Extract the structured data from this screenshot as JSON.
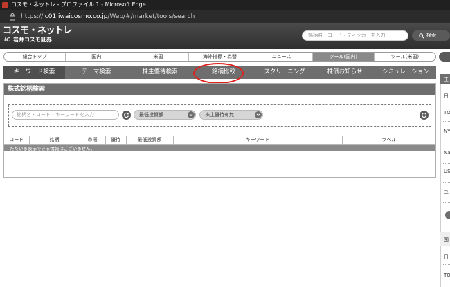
{
  "browser": {
    "title": "コスモ・ネットレ - プロファイル 1 - Microsoft Edge",
    "url_prefix": "https://",
    "url_host": "ic01.iwaicosmo.co.jp",
    "url_path": "/Web/#/market/tools/search"
  },
  "header": {
    "logo_line1": "コスモ・ネットレ",
    "logo_mark": "IC",
    "logo_line2": "岩井コスモ証券",
    "search_placeholder": "銘柄名・コード・ティッカーを入力",
    "search_button": "検索"
  },
  "global_nav": [
    "総合トップ",
    "国内",
    "米国",
    "海外指標・為替",
    "ニュース",
    "ツール(国内)",
    "ツール(米国)"
  ],
  "global_nav_active": 5,
  "sub_nav": [
    "キーワード検索",
    "テーマ検索",
    "株主優待検索",
    "銘柄比較",
    "スクリーニング",
    "株価お知らせ",
    "シミュレーション"
  ],
  "sub_nav_active": 0,
  "panel": {
    "title": "株式銘柄検索",
    "keyword_placeholder": "銘柄名・コード・キーワードを入力",
    "min_investment": "最低投資額",
    "benefit_filter": "株主優待有無"
  },
  "table": {
    "columns": [
      "コード",
      "銘柄",
      "市場",
      "優待",
      "最低投資額",
      "キーワード",
      "ラベル"
    ],
    "empty_message": "ただいま表示できる情報はございません。"
  },
  "right_panel": {
    "chars": [
      "主",
      "日",
      "TO",
      "NY",
      "Na",
      "US",
      "ユ",
      "国",
      "日",
      "TO"
    ]
  },
  "colors": {
    "nav_gray": "#6e6e6e",
    "highlight_red": "#e0201a"
  }
}
